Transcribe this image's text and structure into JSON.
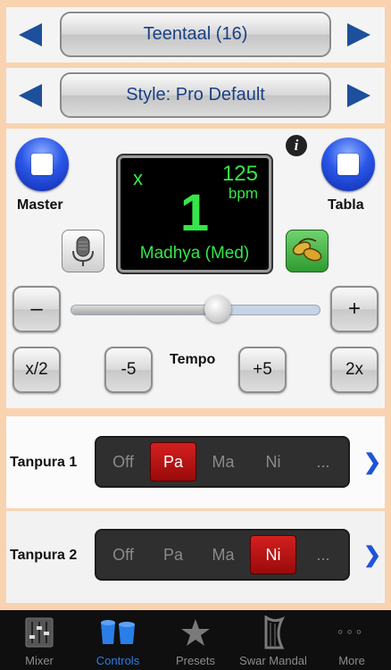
{
  "taal_selector": {
    "label": "Teentaal (16)"
  },
  "style_selector": {
    "label": "Style: Pro Default"
  },
  "controls": {
    "master_label": "Master",
    "tabla_label": "Tabla",
    "info_glyph": "i"
  },
  "display": {
    "multiplier": "x",
    "bpm_value": "125",
    "bpm_unit": "bpm",
    "beat": "1",
    "laya": "Madhya (Med)"
  },
  "tempo": {
    "minus_label": "–",
    "plus_label": "+",
    "half_label": "x/2",
    "minus5_label": "-5",
    "title": "Tempo",
    "plus5_label": "+5",
    "double_label": "2x",
    "slider_level": 0.59
  },
  "tanpura1": {
    "label": "Tanpura 1",
    "options": [
      "Off",
      "Pa",
      "Ma",
      "Ni",
      "..."
    ],
    "selected": "Pa"
  },
  "tanpura2": {
    "label": "Tanpura 2",
    "options": [
      "Off",
      "Pa",
      "Ma",
      "Ni",
      "..."
    ],
    "selected": "Ni"
  },
  "tabbar": {
    "tabs": [
      {
        "label": "Mixer",
        "icon": "mixer-icon"
      },
      {
        "label": "Controls",
        "icon": "tabla-drums-icon",
        "active": true
      },
      {
        "label": "Presets",
        "icon": "star-icon"
      },
      {
        "label": "Swar Mandal",
        "icon": "harp-icon"
      },
      {
        "label": "More",
        "icon": "more-dots-icon"
      }
    ]
  },
  "colors": {
    "accent_blue": "#1d4f9a",
    "display_green": "#35e64a",
    "selected_red": "#c31414",
    "tab_active": "#2a7ee8"
  }
}
